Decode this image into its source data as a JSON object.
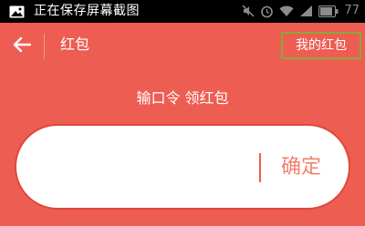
{
  "status_bar": {
    "notification_text": "正在保存屏幕截图",
    "battery_text": "77",
    "icons": [
      "image-icon",
      "mute-icon",
      "alarm-icon",
      "wifi-icon",
      "signal-icon",
      "battery-icon"
    ]
  },
  "header": {
    "back_icon": "arrow-left-icon",
    "title": "红包",
    "my_envelope_label": "我的红包"
  },
  "main": {
    "prompt": "输口令 领红包",
    "input_value": "",
    "input_placeholder": "",
    "confirm_label": "确定"
  },
  "colors": {
    "background": "#ee5d52",
    "status_bar": "#000000",
    "highlight_border": "#8ba83a",
    "confirm_text": "#f0826f"
  }
}
